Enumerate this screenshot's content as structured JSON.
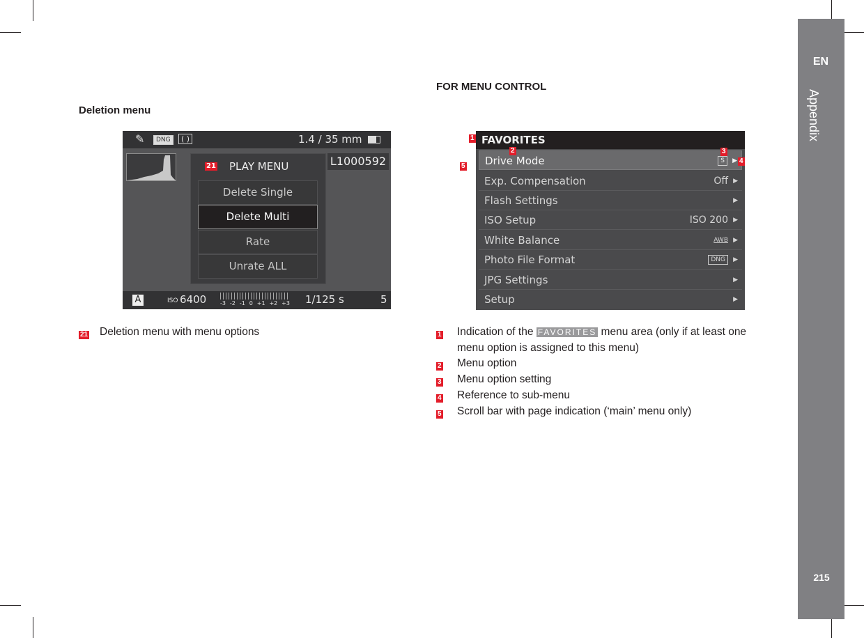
{
  "side_tab": {
    "language": "EN",
    "section": "Appendix",
    "page_number": "215"
  },
  "left": {
    "heading": "Deletion menu",
    "screen": {
      "top_bar": {
        "icons": [
          "pipette-icon",
          "dng-icon",
          "metering-icon"
        ],
        "lens": "1.4 / 35 mm",
        "battery_icon": "battery-icon"
      },
      "file_id": "L1000592",
      "play_menu": {
        "badge": "21",
        "title": "PLAY MENU",
        "options": [
          {
            "label": "Delete Single",
            "selected": false
          },
          {
            "label": "Delete Multi",
            "selected": true
          },
          {
            "label": "Rate",
            "selected": false
          },
          {
            "label": "Unrate ALL",
            "selected": false
          }
        ]
      },
      "bottom_bar": {
        "mode": "A",
        "iso_prefix": "ISO",
        "iso_value": "6400",
        "exposure_scale": [
          "-3",
          "-2",
          "-1",
          "0",
          "+1",
          "+2",
          "+3"
        ],
        "shutter": "1/125 s",
        "count": "5"
      }
    },
    "legend": [
      {
        "badge": "21",
        "text": "Deletion menu with menu options"
      }
    ]
  },
  "right": {
    "heading": "FOR MENU CONTROL",
    "screen": {
      "header": "FAVORITES",
      "rows": [
        {
          "label": "Drive Mode",
          "value": "S",
          "value_style": "boxed",
          "selected": true
        },
        {
          "label": "Exp. Compensation",
          "value": "Off",
          "value_style": "text",
          "selected": false
        },
        {
          "label": "Flash Settings",
          "value": "",
          "value_style": "text",
          "selected": false
        },
        {
          "label": "ISO Setup",
          "value": "ISO 200",
          "value_style": "text",
          "selected": false
        },
        {
          "label": "White Balance",
          "value": "AWB",
          "value_style": "underlined",
          "selected": false
        },
        {
          "label": "Photo File Format",
          "value": "DNG",
          "value_style": "boxed",
          "selected": false
        },
        {
          "label": "JPG Settings",
          "value": "",
          "value_style": "text",
          "selected": false
        },
        {
          "label": "Setup",
          "value": "",
          "value_style": "text",
          "selected": false
        }
      ],
      "callouts": [
        "1",
        "2",
        "3",
        "4",
        "5"
      ]
    },
    "legend": [
      {
        "badge": "1",
        "text_before": "Indication of the",
        "chip": "FAVORITES",
        "text_after": "menu area (only if at least one",
        "text_cont": "menu option is assigned to this menu)"
      },
      {
        "badge": "2",
        "text": "Menu option"
      },
      {
        "badge": "3",
        "text": "Menu option setting"
      },
      {
        "badge": "4",
        "text": "Reference to sub-menu"
      },
      {
        "badge": "5",
        "text": "Scroll bar with page indication (‘main’ menu only)"
      }
    ]
  },
  "colors": {
    "badge_red": "#e31d2a",
    "side_tab_gray": "#808083"
  }
}
